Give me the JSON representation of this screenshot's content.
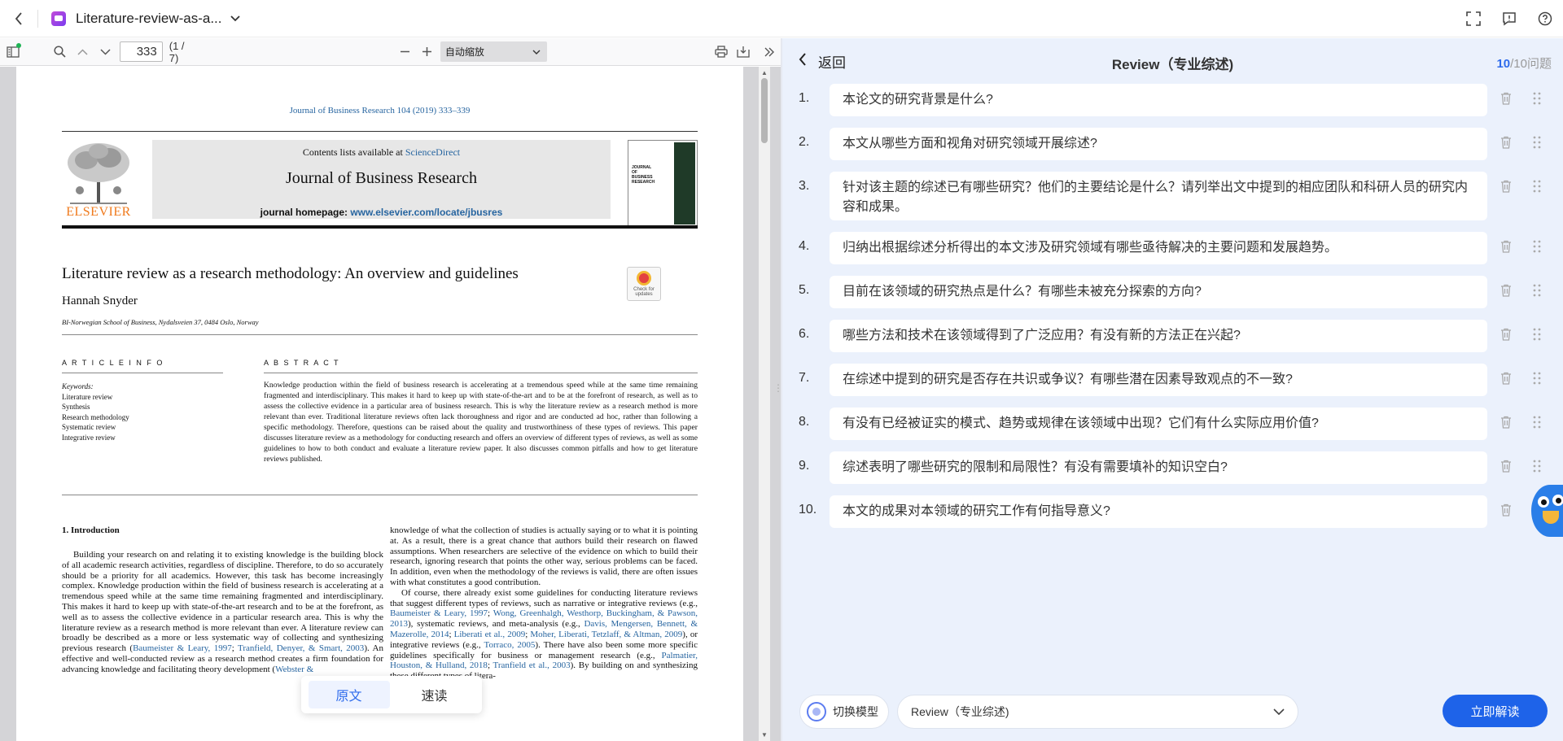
{
  "topbar": {
    "doc_title": "Literature-review-as-a...",
    "icons": [
      "back-icon",
      "fullscreen-icon",
      "feedback-icon",
      "help-icon"
    ]
  },
  "pdf_toolbar": {
    "page_number": "333",
    "page_count": "(1 / 7)",
    "zoom": "自动缩放"
  },
  "pdf": {
    "journal_ref": "Journal of Business Research 104 (2019) 333–339",
    "contents_prefix": "Contents lists available at ",
    "contents_link": "ScienceDirect",
    "journal_title": "Journal of Business Research",
    "homepage_prefix": "journal homepage: ",
    "homepage_url": "www.elsevier.com/locate/jbusres",
    "publisher": "ELSEVIER",
    "cover_text": "JOURNAL OF BUSINESS RESEARCH",
    "badge_text": "Check for updates",
    "article_title": "Literature review as a research methodology: An overview and guidelines",
    "author": "Hannah Snyder",
    "affiliation": "BI-Norwegian School of Business, Nydalsveien 37, 0484 Oslo, Norway",
    "article_info_head": "A R T I C L E   I N F O",
    "abstract_head": "A B S T R A C T",
    "keywords_label": "Keywords:",
    "keywords": [
      "Literature review",
      "Synthesis",
      "Research methodology",
      "Systematic review",
      "Integrative review"
    ],
    "abstract": "Knowledge production within the field of business research is accelerating at a tremendous speed while at the same time remaining fragmented and interdisciplinary. This makes it hard to keep up with state-of-the-art and to be at the forefront of research, as well as to assess the collective evidence in a particular area of business research. This is why the literature review as a research method is more relevant than ever. Traditional literature reviews often lack thoroughness and rigor and are conducted ad hoc, rather than following a specific methodology. Therefore, questions can be raised about the quality and trustworthiness of these types of reviews. This paper discusses literature review as a methodology for conducting research and offers an overview of different types of reviews, as well as some guidelines to how to both conduct and evaluate a literature review paper. It also discusses common pitfalls and how to get literature reviews published.",
    "intro_head": "1.  Introduction",
    "left_col_1": "Building your research on and relating it to existing knowledge is the building block of all academic research activities, regardless of discipline. Therefore, to do so accurately should be a priority for all academics. However, this task has become increasingly complex. Knowledge production within the field of business research is accelerating at a tremendous speed while at the same time remaining fragmented and interdisciplinary. This makes it hard to keep up with state-of-the-art research and to be at the forefront, as well as to assess the collective evidence in a particular research area. This is why the literature review as a research method is more relevant than ever. A literature review can broadly be described as a more or less systematic way of collecting and synthesizing previous research (",
    "left_col_link1": "Baumeister & Leary, 1997",
    "left_col_sep": "; ",
    "left_col_link2": "Tranfield, Denyer, & Smart, 2003",
    "left_col_2": "). An effective and well-conducted review as a research method creates a firm foundation for advancing knowledge and facilitating theory development (",
    "left_col_link3": "Webster &",
    "right_col_1": "knowledge of what the collection of studies is actually saying or to what it is pointing at. As a result, there is a great chance that authors build their research on flawed assumptions. When researchers are selective of the evidence on which to build their research, ignoring research that points the other way, serious problems can be faced. In addition, even when the methodology of the reviews is valid, there are often issues with what constitutes a good contribution.",
    "right_col_2": "Of course, there already exist some guidelines for conducting literature reviews that suggest different types of reviews, such as narrative or integrative reviews (e.g., ",
    "right_col_link1": "Baumeister & Leary, 1997",
    "right_col_link2": "Wong, Greenhalgh, Westhorp, Buckingham, & Pawson, 2013",
    "right_col_3": "), systematic reviews, and meta-analysis (e.g., ",
    "right_col_link3": "Davis, Mengersen, Bennett, & Mazerolle, 2014",
    "right_col_link4": "Liberati et al., 2009",
    "right_col_link5": "Moher, Liberati, Tetzlaff, & Altman, 2009",
    "right_col_4": "), or integrative reviews (e.g., ",
    "right_col_link6": "Torraco, 2005",
    "right_col_5": "). There have also been some more specific guidelines specifically for business or management research (e.g., ",
    "right_col_link7": "Palmatier, Houston, & Hulland, 2018",
    "right_col_link8": "Tranfield et al., 2003",
    "right_col_6": "). By building on and synthesizing these different types of litera-"
  },
  "read_mode": {
    "original": "原文",
    "speed": "速读"
  },
  "panel": {
    "back_label": "返回",
    "title": "Review（专业综述)",
    "count_current": "10",
    "count_rest": "/10问题",
    "questions": [
      {
        "num": "1.",
        "text": "本论文的研究背景是什么?"
      },
      {
        "num": "2.",
        "text": "本文从哪些方面和视角对研究领域开展综述?"
      },
      {
        "num": "3.",
        "text": "针对该主题的综述已有哪些研究？他们的主要结论是什么？请列举出文中提到的相应团队和科研人员的研究内容和成果。"
      },
      {
        "num": "4.",
        "text": "归纳出根据综述分析得出的本文涉及研究领域有哪些亟待解决的主要问题和发展趋势。"
      },
      {
        "num": "5.",
        "text": "目前在该领域的研究热点是什么？有哪些未被充分探索的方向?"
      },
      {
        "num": "6.",
        "text": "哪些方法和技术在该领域得到了广泛应用？有没有新的方法正在兴起?"
      },
      {
        "num": "7.",
        "text": "在综述中提到的研究是否存在共识或争议？有哪些潜在因素导致观点的不一致?"
      },
      {
        "num": "8.",
        "text": "有没有已经被证实的模式、趋势或规律在该领域中出现？它们有什么实际应用价值?"
      },
      {
        "num": "9.",
        "text": "综述表明了哪些研究的限制和局限性？有没有需要填补的知识空白?"
      },
      {
        "num": "10.",
        "text": "本文的成果对本领域的研究工作有何指导意义?"
      }
    ]
  },
  "footer": {
    "switch_model": "切换模型",
    "selected_template": "Review（专业综述)",
    "analyze": "立即解读"
  },
  "colors": {
    "accent": "#1e63e9",
    "panel_bg": "#ebf1fc",
    "link": "#2765a0",
    "elsevier_orange": "#f07a1c"
  }
}
